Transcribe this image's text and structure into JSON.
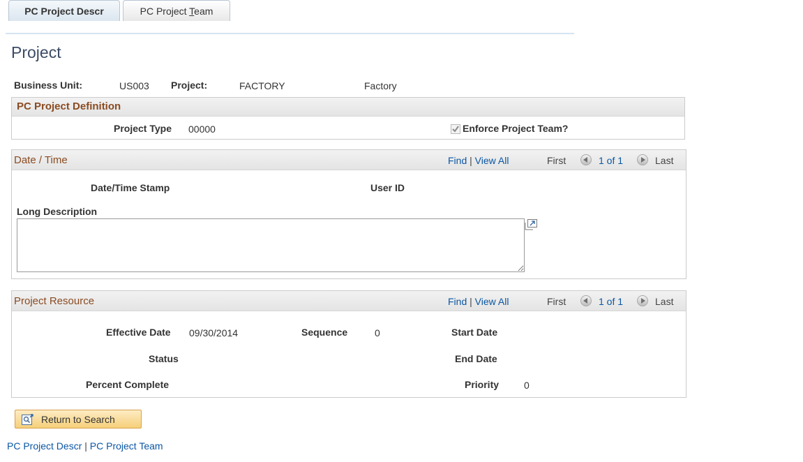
{
  "tabs": [
    {
      "label": "PC Project Descr",
      "active": true
    },
    {
      "label_pre": "PC Project ",
      "label_key": "T",
      "label_post": "eam",
      "active": false
    }
  ],
  "page_title": "Project",
  "header": {
    "business_unit_label": "Business Unit:",
    "business_unit_value": "US003",
    "project_label": "Project:",
    "project_value": "FACTORY",
    "project_desc": "Factory"
  },
  "definition": {
    "title": "PC Project Definition",
    "project_type_label": "Project Type",
    "project_type_value": "00000",
    "enforce_label": "Enforce Project Team?",
    "enforce_checked": true
  },
  "datetime": {
    "title": "Date / Time",
    "find": "Find",
    "sep": "|",
    "view_all": "View All",
    "first": "First",
    "pager": "1 of 1",
    "last": "Last",
    "stamp_label": "Date/Time Stamp",
    "user_label": "User ID",
    "long_desc_label": "Long Description",
    "long_desc_value": ""
  },
  "resource": {
    "title": "Project Resource",
    "find": "Find",
    "sep": "|",
    "view_all": "View All",
    "first": "First",
    "pager": "1 of 1",
    "last": "Last",
    "effective_date_label": "Effective Date",
    "effective_date_value": "09/30/2014",
    "sequence_label": "Sequence",
    "sequence_value": "0",
    "start_date_label": "Start Date",
    "status_label": "Status",
    "end_date_label": "End Date",
    "percent_label": "Percent Complete",
    "priority_label": "Priority",
    "priority_value": "0"
  },
  "return_button": "Return to Search",
  "footer_links": {
    "descr": "PC Project Descr",
    "sep": "|",
    "team": "PC Project Team"
  },
  "colors": {
    "link": "#0a56a3",
    "section_title": "#8a4b21",
    "button": "#f6cf7a"
  }
}
